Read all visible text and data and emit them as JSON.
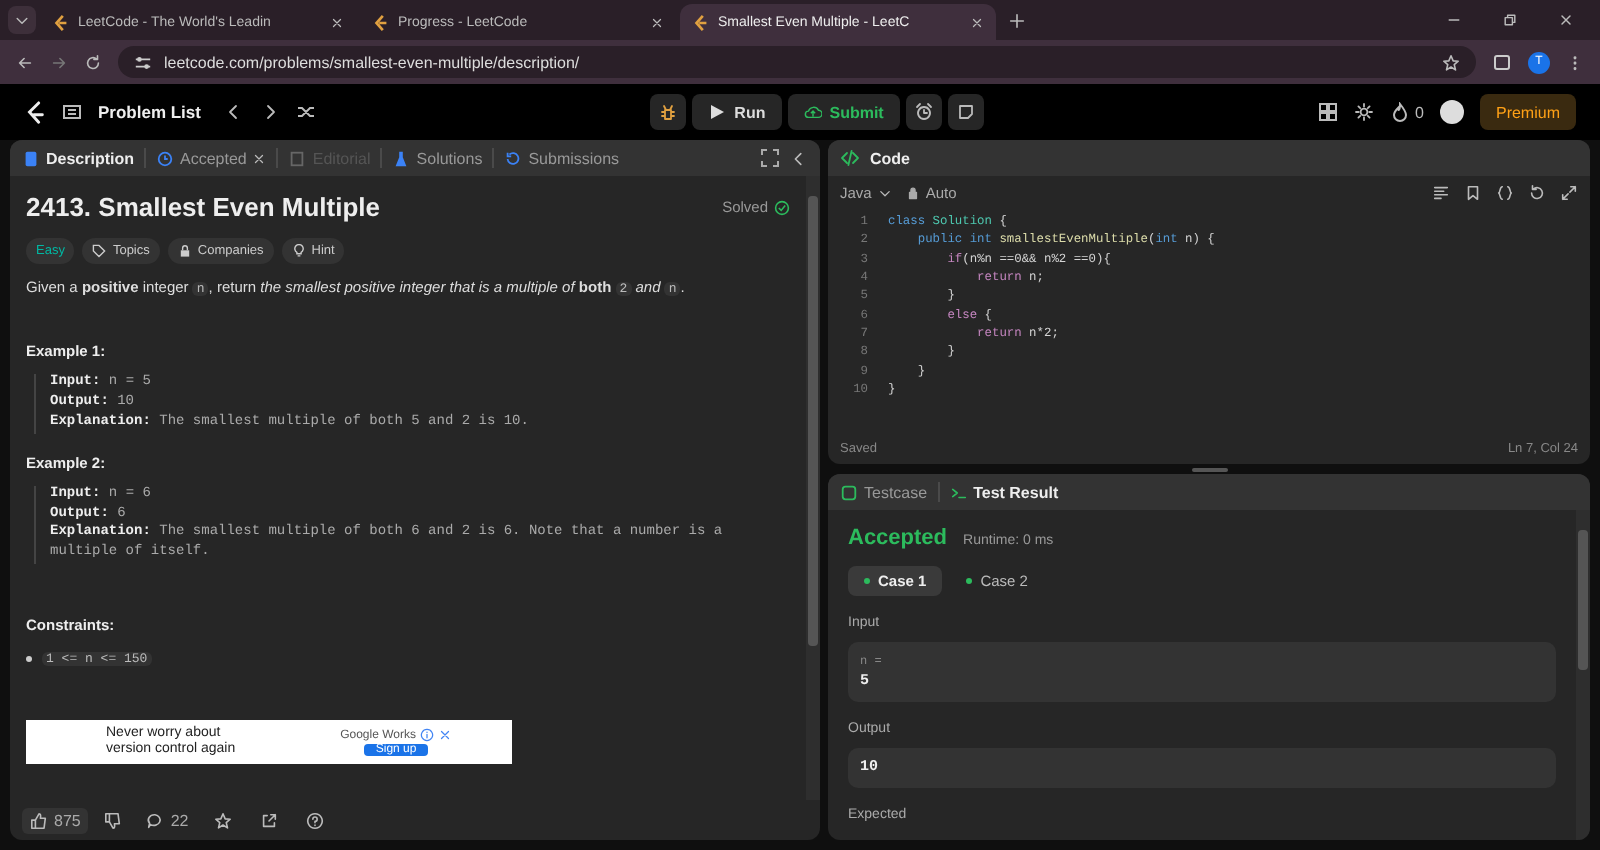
{
  "browser": {
    "tabs": [
      {
        "title": "LeetCode - The World's Leadin",
        "selected": false
      },
      {
        "title": "Progress - LeetCode",
        "selected": false
      },
      {
        "title": "Smallest Even Multiple - LeetC",
        "selected": true
      }
    ],
    "url": "leetcode.com/problems/smallest-even-multiple/description/",
    "profile": "T"
  },
  "nav": {
    "problem_list": "Problem List",
    "run": "Run",
    "submit": "Submit",
    "streak": "0",
    "premium": "Premium"
  },
  "description_panel": {
    "tabs": [
      {
        "label": "Description",
        "selected": true,
        "disabled": false,
        "closable": false,
        "kind": "doc"
      },
      {
        "label": "Accepted",
        "selected": false,
        "disabled": false,
        "closable": true,
        "kind": "clock"
      },
      {
        "label": "Editorial",
        "selected": false,
        "disabled": true,
        "closable": false,
        "kind": "book"
      },
      {
        "label": "Solutions",
        "selected": false,
        "disabled": false,
        "closable": false,
        "kind": "flask"
      },
      {
        "label": "Submissions",
        "selected": false,
        "disabled": false,
        "closable": false,
        "kind": "history"
      }
    ],
    "title": "2413. Smallest Even Multiple",
    "status": "Solved",
    "tags": [
      {
        "label": "Easy",
        "kind": "difficulty"
      },
      {
        "label": "Topics",
        "kind": "topics"
      },
      {
        "label": "Companies",
        "kind": "companies"
      },
      {
        "label": "Hint",
        "kind": "hint"
      }
    ],
    "statement": [
      {
        "kind": "text",
        "text": "Given a **positive** integer "
      },
      {
        "kind": "code",
        "text": "n"
      },
      {
        "kind": "text",
        "text": ", return *the smallest positive integer that is a multiple of* **both** "
      },
      {
        "kind": "code",
        "text": "2"
      },
      {
        "kind": "text",
        "text": " *and* "
      },
      {
        "kind": "code",
        "text": "n"
      },
      {
        "kind": "text",
        "text": "."
      }
    ],
    "examples": [
      {
        "heading": "Example 1:",
        "lines": [
          {
            "label": "Input:",
            "value": "n = 5"
          },
          {
            "label": "Output:",
            "value": "10"
          },
          {
            "label": "Explanation:",
            "value": "The smallest multiple of both 5 and 2 is 10."
          }
        ]
      },
      {
        "heading": "Example 2:",
        "lines": [
          {
            "label": "Input:",
            "value": "n = 6"
          },
          {
            "label": "Output:",
            "value": "6"
          },
          {
            "label": "Explanation:",
            "value": "The smallest multiple of both 6 and 2 is 6. Note that a number is a multiple of itself."
          }
        ]
      }
    ],
    "constraints_heading": "Constraints:",
    "constraints": [
      "1 <= n <= 150"
    ],
    "ad": {
      "headline": "Never worry about version control again",
      "brand": "Google Works",
      "button": "Sign up"
    },
    "footer": {
      "likes": "875",
      "comments": "22"
    }
  },
  "code_panel": {
    "title": "Code",
    "language": "Java",
    "mode": "Auto",
    "lines": [
      {
        "number": "1",
        "tokens": [
          {
            "kind": "kw",
            "text": "class "
          },
          {
            "kind": "type",
            "text": "Solution"
          },
          {
            "kind": "p",
            "text": " {"
          }
        ]
      },
      {
        "number": "2",
        "tokens": [
          {
            "kind": "kw",
            "text": "    public int "
          },
          {
            "kind": "fn",
            "text": "smallestEvenMultiple"
          },
          {
            "kind": "p",
            "text": "("
          },
          {
            "kind": "kw",
            "text": "int"
          },
          {
            "kind": "p",
            "text": " n) {"
          }
        ]
      },
      {
        "number": "3",
        "tokens": [
          {
            "kind": "ctl",
            "text": "        if"
          },
          {
            "kind": "p",
            "text": "(n%n ==0&& n%2 ==0){"
          }
        ]
      },
      {
        "number": "4",
        "tokens": [
          {
            "kind": "ctl",
            "text": "            return"
          },
          {
            "kind": "p",
            "text": " n;"
          }
        ]
      },
      {
        "number": "5",
        "tokens": [
          {
            "kind": "p",
            "text": "        }"
          }
        ]
      },
      {
        "number": "6",
        "tokens": [
          {
            "kind": "ctl",
            "text": "        else"
          },
          {
            "kind": "p",
            "text": " {"
          }
        ]
      },
      {
        "number": "7",
        "tokens": [
          {
            "kind": "ctl",
            "text": "            return"
          },
          {
            "kind": "p",
            "text": " n*2;"
          }
        ]
      },
      {
        "number": "8",
        "tokens": [
          {
            "kind": "p",
            "text": "        }"
          }
        ]
      },
      {
        "number": "9",
        "tokens": [
          {
            "kind": "p",
            "text": "    }"
          }
        ]
      },
      {
        "number": "10",
        "tokens": [
          {
            "kind": "p",
            "text": "}"
          }
        ]
      }
    ],
    "saved": "Saved",
    "cursor": "Ln 7, Col 24"
  },
  "result_panel": {
    "tabs": [
      {
        "label": "Testcase",
        "selected": false
      },
      {
        "label": "Test Result",
        "selected": true
      }
    ],
    "verdict": "Accepted",
    "runtime": "Runtime: 0 ms",
    "cases": [
      {
        "label": "Case 1",
        "selected": true,
        "passed": true
      },
      {
        "label": "Case 2",
        "selected": false,
        "passed": true
      }
    ],
    "input_heading": "Input",
    "input_name": "n =",
    "input_value": "5",
    "output_heading": "Output",
    "output_value": "10",
    "expected_heading": "Expected"
  }
}
